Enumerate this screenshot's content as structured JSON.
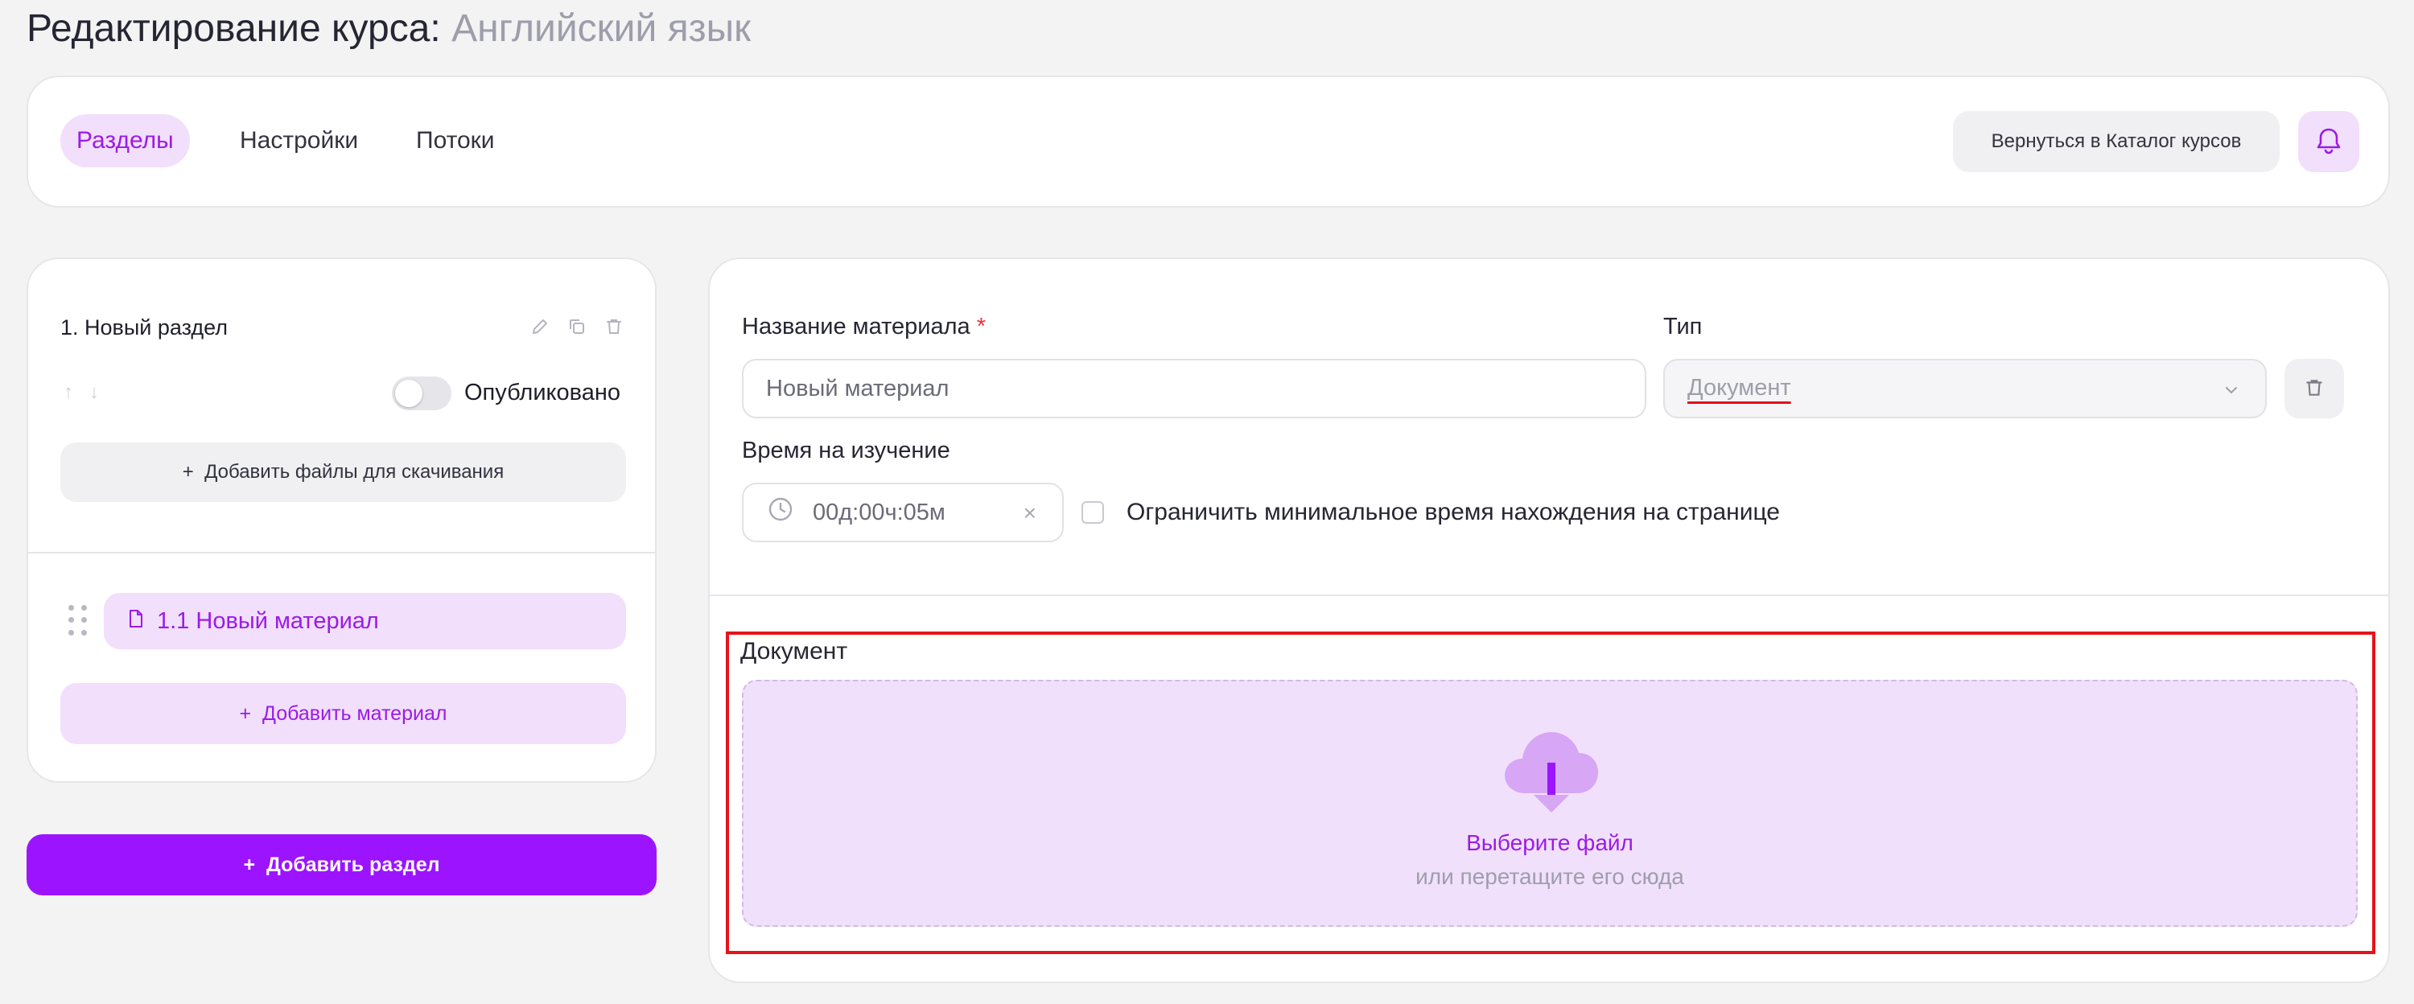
{
  "page": {
    "title_prefix": "Редактирование курса:",
    "course_name": "Английский язык"
  },
  "tabs": [
    {
      "label": "Разделы",
      "active": true
    },
    {
      "label": "Настройки",
      "active": false
    },
    {
      "label": "Потоки",
      "active": false
    }
  ],
  "header": {
    "back_label": "Вернуться в Каталог курсов",
    "bell_icon": "bell-icon"
  },
  "section": {
    "title": "1. Новый раздел",
    "published_label": "Опубликовано",
    "published": false,
    "add_files_label": "Добавить файлы для скачивания",
    "materials": [
      {
        "label": "1.1 Новый материал",
        "icon": "document-icon"
      }
    ],
    "add_material_label": "Добавить материал"
  },
  "add_section_label": "Добавить раздел",
  "editor": {
    "name_label": "Название материала",
    "required_mark": "*",
    "name_value": "Новый материал",
    "type_label": "Тип",
    "type_value": "Документ",
    "time_label": "Время на изучение",
    "time_value": "00д:00ч:05м",
    "time_clear": "×",
    "limit_label": "Ограничить минимальное время нахождения на странице",
    "limit_checked": false,
    "doc_label": "Документ",
    "upload_title": "Выберите файл",
    "upload_hint": "или перетащите его сюда"
  },
  "colors": {
    "accent": "#9c14ff",
    "accent_soft": "#f1dffc",
    "highlight": "#e5141a"
  }
}
